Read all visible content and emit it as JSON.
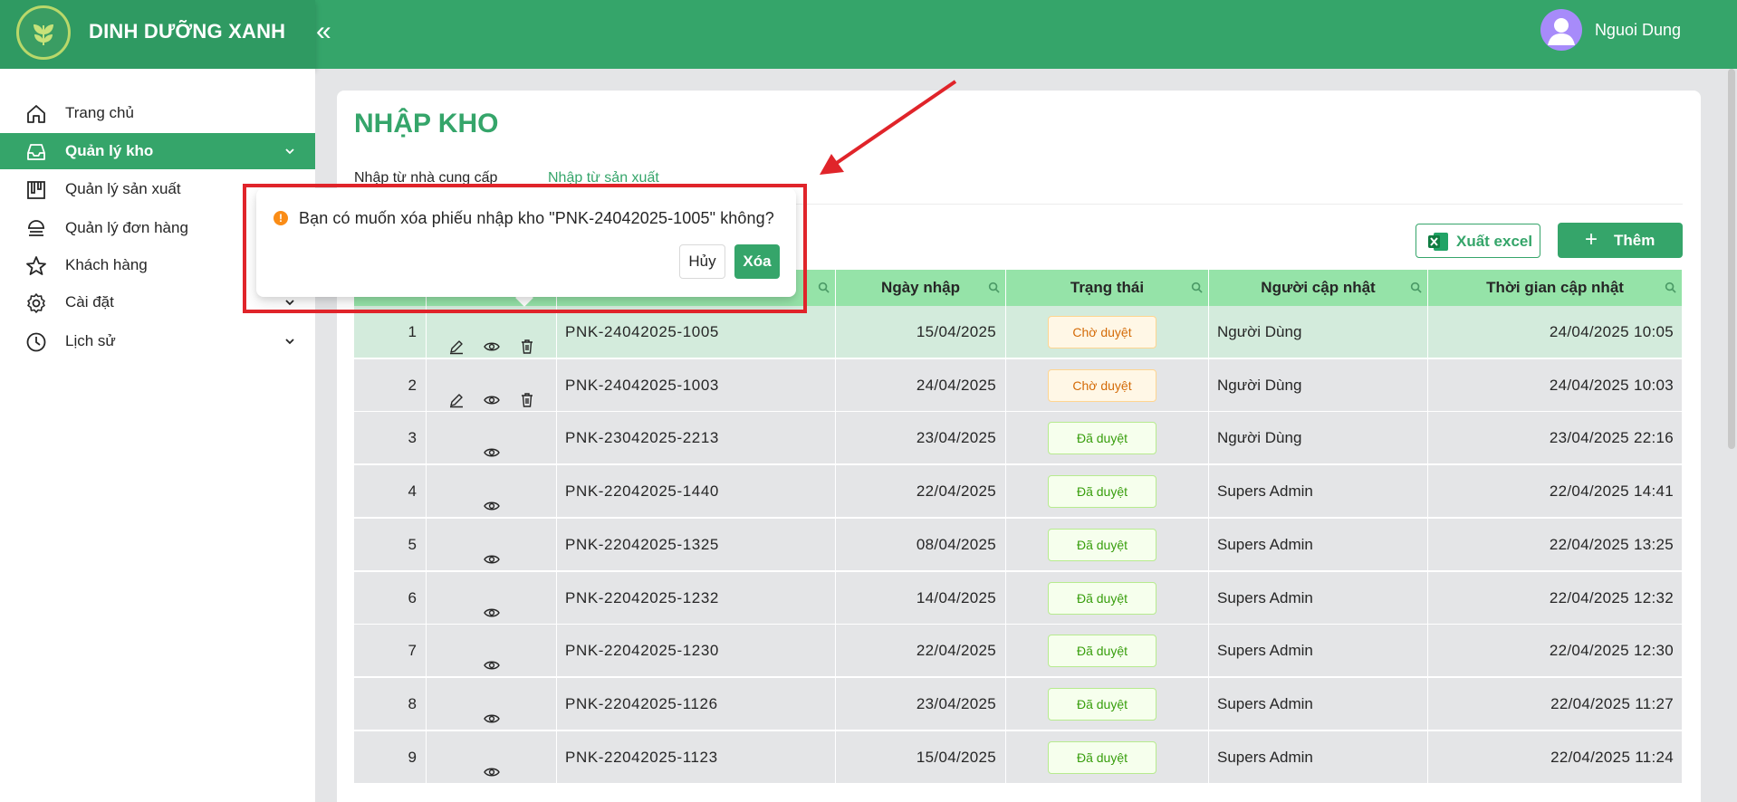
{
  "app": {
    "brand": "DINH DƯỠNG XANH",
    "user_name": "Nguoi Dung"
  },
  "sidebar": {
    "items": [
      {
        "label": "Trang chủ",
        "icon": "home-icon"
      },
      {
        "label": "Quản lý kho",
        "icon": "inbox-icon",
        "active": true
      },
      {
        "label": "Quản lý sản xuất",
        "icon": "factory-icon"
      },
      {
        "label": "Quản lý đơn hàng",
        "icon": "order-icon"
      },
      {
        "label": "Khách hàng",
        "icon": "star-icon"
      },
      {
        "label": "Cài đặt",
        "icon": "gear-icon"
      },
      {
        "label": "Lịch sử",
        "icon": "history-icon"
      }
    ]
  },
  "page": {
    "title": "NHẬP KHO",
    "tabs": [
      "Nhập từ nhà cung cấp",
      "Nhập từ sản xuất"
    ],
    "active_tab": 1,
    "export_label": "Xuất excel",
    "add_label": "Thêm"
  },
  "table": {
    "columns": [
      "",
      "",
      "",
      "Ngày nhập",
      "Trạng thái",
      "Người cập nhật",
      "Thời gian cập nhật"
    ],
    "rows": [
      {
        "stt": "1",
        "code": "PNK-24042025-1005",
        "date": "15/04/2025",
        "status": "Chờ duyệt",
        "user": "Người Dùng",
        "time": "24/04/2025 10:05",
        "editable": true
      },
      {
        "stt": "2",
        "code": "PNK-24042025-1003",
        "date": "24/04/2025",
        "status": "Chờ duyệt",
        "user": "Người Dùng",
        "time": "24/04/2025 10:03",
        "editable": true
      },
      {
        "stt": "3",
        "code": "PNK-23042025-2213",
        "date": "23/04/2025",
        "status": "Đã duyệt",
        "user": "Người Dùng",
        "time": "23/04/2025 22:16",
        "editable": false
      },
      {
        "stt": "4",
        "code": "PNK-22042025-1440",
        "date": "22/04/2025",
        "status": "Đã duyệt",
        "user": "Supers Admin",
        "time": "22/04/2025 14:41",
        "editable": false
      },
      {
        "stt": "5",
        "code": "PNK-22042025-1325",
        "date": "08/04/2025",
        "status": "Đã duyệt",
        "user": "Supers Admin",
        "time": "22/04/2025 13:25",
        "editable": false
      },
      {
        "stt": "6",
        "code": "PNK-22042025-1232",
        "date": "14/04/2025",
        "status": "Đã duyệt",
        "user": "Supers Admin",
        "time": "22/04/2025 12:32",
        "editable": false
      },
      {
        "stt": "7",
        "code": "PNK-22042025-1230",
        "date": "22/04/2025",
        "status": "Đã duyệt",
        "user": "Supers Admin",
        "time": "22/04/2025 12:30",
        "editable": false
      },
      {
        "stt": "8",
        "code": "PNK-22042025-1126",
        "date": "23/04/2025",
        "status": "Đã duyệt",
        "user": "Supers Admin",
        "time": "22/04/2025 11:27",
        "editable": false
      },
      {
        "stt": "9",
        "code": "PNK-22042025-1123",
        "date": "15/04/2025",
        "status": "Đã duyệt",
        "user": "Supers Admin",
        "time": "22/04/2025 11:24",
        "editable": false
      }
    ]
  },
  "popconfirm": {
    "message": "Bạn có muốn xóa phiếu nhập kho \"PNK-24042025-1005\" không?",
    "cancel_label": "Hủy",
    "ok_label": "Xóa"
  },
  "colors": {
    "primary": "#35a56a",
    "header_row": "#95e3a8",
    "pending": "#d46b08",
    "approved": "#389e0d",
    "annotation": "#e0242a"
  }
}
